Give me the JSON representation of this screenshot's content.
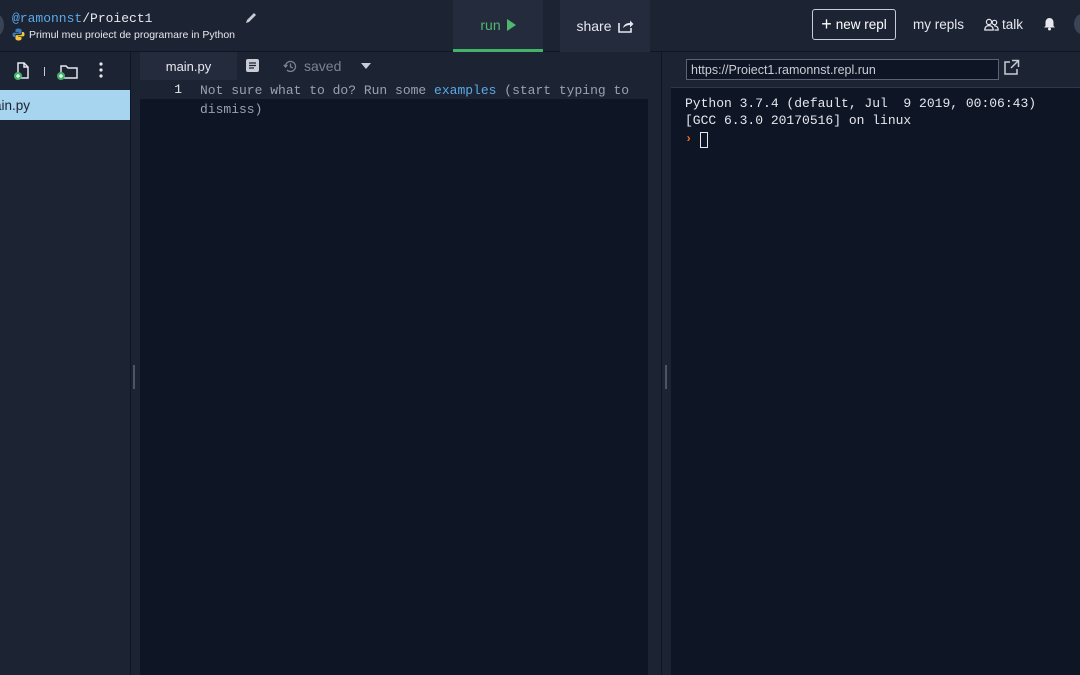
{
  "header": {
    "owner": "@ramonnst",
    "separator": "/",
    "repl_name": "Proiect1",
    "description": "Primul meu proiect de programare in Python",
    "run_label": "run",
    "share_label": "share",
    "new_repl_label": "new repl",
    "my_repls_label": "my repls",
    "talk_label": "talk"
  },
  "filetree": {
    "files": [
      {
        "name": "main.py",
        "shown_text": "ain.py",
        "selected": true
      }
    ]
  },
  "editor": {
    "tab_label": "main.py",
    "status": "saved",
    "line_number": "1",
    "placeholder_before": "Not sure what to do? Run some ",
    "placeholder_link": "examples",
    "placeholder_after": " (start typing to dismiss)"
  },
  "console": {
    "url": "https://Proiect1.ramonnst.repl.run",
    "lines": [
      "Python 3.7.4 (default, Jul  9 2019, 00:06:43)",
      "[GCC 6.3.0 20170516] on linux"
    ],
    "prompt": "›"
  },
  "colors": {
    "background": "#0e1525",
    "panel": "#1c2333",
    "accent_run": "#44b36a",
    "link": "#5aa9e6",
    "selected_file": "#a7d4ef",
    "prompt": "#f26f21"
  },
  "icons": [
    "pencil-icon",
    "python-icon",
    "play-icon",
    "share-icon",
    "plus-icon",
    "people-icon",
    "bell-icon",
    "add-file-icon",
    "add-folder-icon",
    "kebab-icon",
    "document-icon",
    "history-icon",
    "caret-down-icon",
    "open-in-new-tab-icon"
  ]
}
